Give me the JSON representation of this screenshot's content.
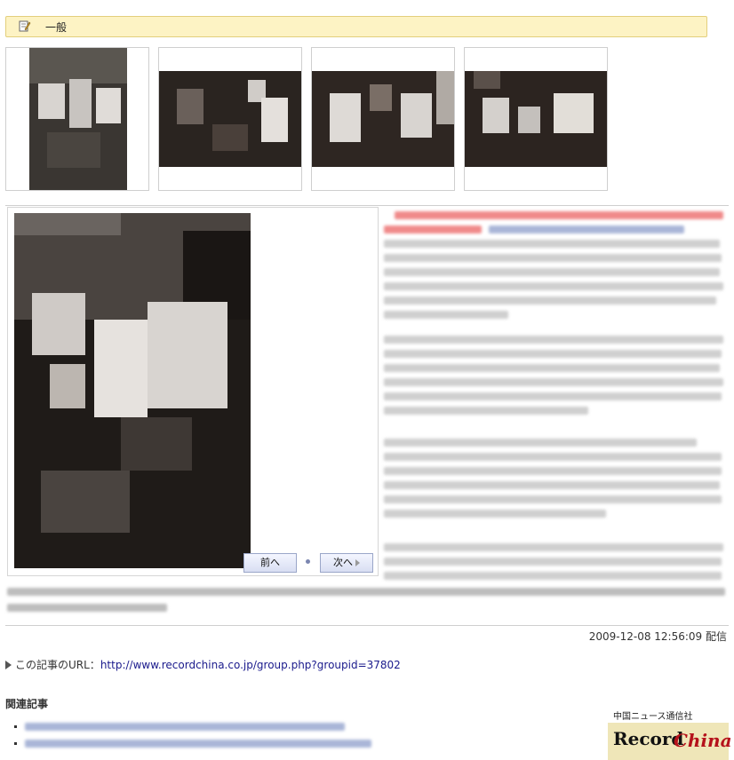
{
  "category": {
    "icon": "edit-note-icon",
    "label": "一般"
  },
  "thumbnails": [
    {
      "name": "thumbnail-1"
    },
    {
      "name": "thumbnail-2"
    },
    {
      "name": "thumbnail-3"
    },
    {
      "name": "thumbnail-4"
    }
  ],
  "gallery": {
    "prev_label": "前へ",
    "next_label": "次へ"
  },
  "footer": {
    "date": "2009-12-08 12:56:09 配信",
    "url_prefix": "この記事のURL：",
    "url": "http://www.recordchina.co.jp/group.php?groupid=37802",
    "related_heading": "関連記事"
  },
  "logo": {
    "tagline": "中国ニュース通信社",
    "word1": "Record",
    "word2": "China"
  },
  "colors": {
    "category_bg": "#fdf3c4",
    "link": "#1a1a8c",
    "logo_red": "#b5121b"
  }
}
